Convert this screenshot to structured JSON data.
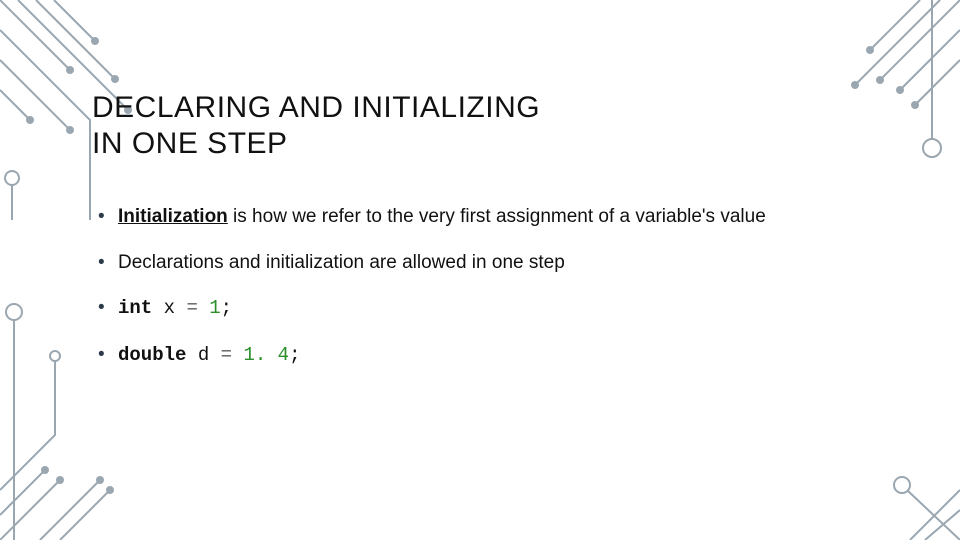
{
  "title_line1": "DECLARING AND INITIALIZING",
  "title_line2": "IN ONE STEP",
  "bullets": {
    "b1_strong": "Initialization",
    "b1_rest": " is how we refer to the very first assignment of a variable's value",
    "b2": "Declarations and initialization are allowed in one step",
    "b3_kw": "int",
    "b3_var": " x ",
    "b3_eq": "=",
    "b3_val": " 1",
    "b3_semi": ";",
    "b4_kw": "double",
    "b4_var": " d ",
    "b4_eq": "=",
    "b4_val": " 1. 4",
    "b4_semi": ";"
  }
}
